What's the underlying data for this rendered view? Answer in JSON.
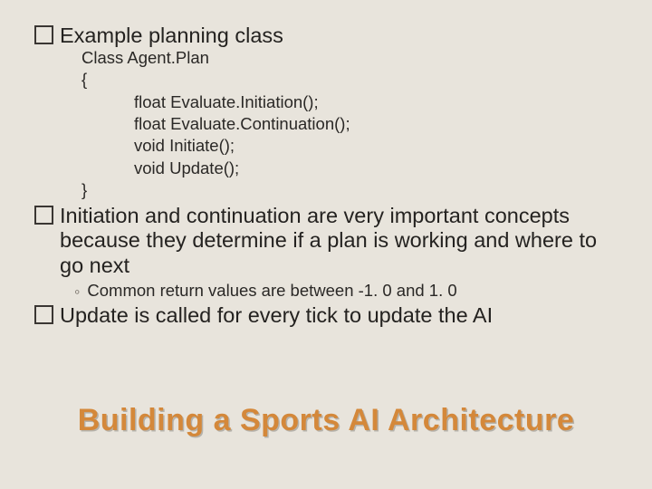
{
  "bullets": {
    "b1": {
      "text": "Example planning class"
    },
    "b2": {
      "text": "Initiation and continuation are very important concepts because they determine if a plan is working and where to go next"
    },
    "b3": {
      "text": "Update is called for every tick to update the AI"
    }
  },
  "code": {
    "l1": "Class Agent.Plan",
    "l2": "{",
    "l3": "float Evaluate.Initiation();",
    "l4": "float Evaluate.Continuation();",
    "l5": "void Initiate();",
    "l6": "void Update();",
    "l7": "}"
  },
  "sub": {
    "marker": "◦",
    "text": "Common return values are between -1. 0 and 1. 0"
  },
  "title": "Building a Sports AI Architecture"
}
